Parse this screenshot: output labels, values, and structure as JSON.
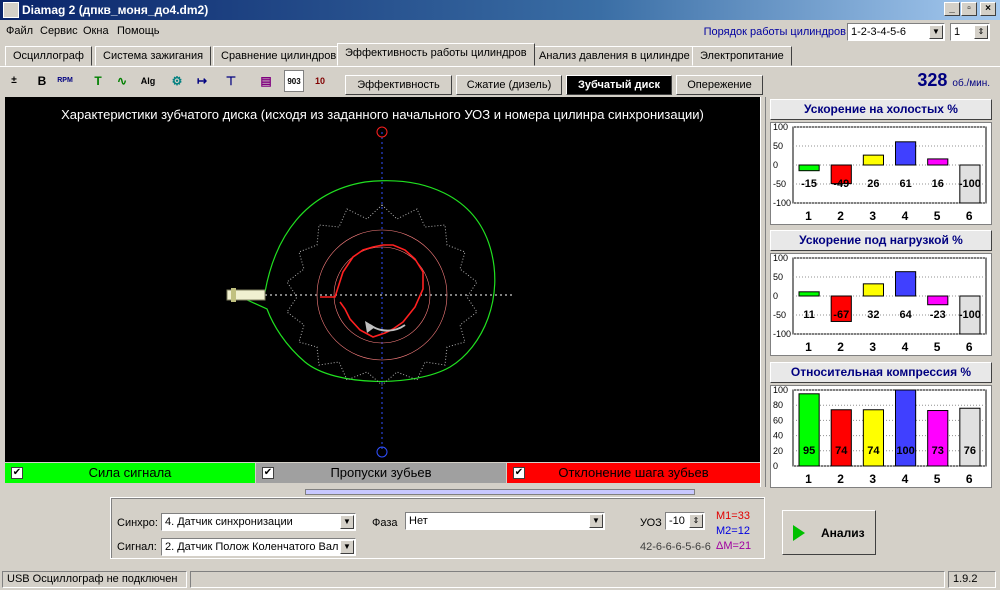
{
  "window": {
    "title": "Diamag 2 (дпкв_моня_до4.dm2)"
  },
  "menu": [
    "Файл",
    "Сервис",
    "Окна",
    "Помощь"
  ],
  "cylinder_order": {
    "label": "Порядок работы цилиндров",
    "value": "1-2-3-4-5-6",
    "cyl_num": "1"
  },
  "tabs": [
    "Осциллограф",
    "Система зажигания",
    "Сравнение цилиндров",
    "Эффективность работы цилиндров",
    "Анализ давления в цилиндре",
    "Электропитание"
  ],
  "toolbar": {
    "icons": [
      "±",
      "B",
      "RPM",
      "T",
      "∿",
      "Alg",
      "⚙",
      "↦",
      "⊤",
      "▤",
      "903",
      "10"
    ]
  },
  "subtabs": [
    "Эффективность",
    "Сжатие (дизель)",
    "Зубчатый диск",
    "Опережение"
  ],
  "rpm": {
    "value": "328",
    "unit": "об./мин."
  },
  "canvas": {
    "title": "Характеристики зубчатого диска (исходя из заданного начального УОЗ и номера цилинра синхронизации)"
  },
  "toggles": [
    {
      "label": "Сила сигнала",
      "color": "#00ff00"
    },
    {
      "label": "Пропуски зубьев",
      "color": "#a0a0a0"
    },
    {
      "label": "Отклонение шага зубьев",
      "color": "#ff0000"
    }
  ],
  "checkmark": "✔",
  "chart_data": [
    {
      "type": "bar",
      "title": "Ускорение на холостых %",
      "categories": [
        "1",
        "2",
        "3",
        "4",
        "5",
        "6"
      ],
      "values": [
        -15,
        -49,
        26,
        61,
        16,
        -100
      ],
      "ylim": [
        -100,
        100
      ],
      "yticks": [
        "100",
        "50",
        "0",
        "-50",
        "-100"
      ]
    },
    {
      "type": "bar",
      "title": "Ускорение под нагрузкой %",
      "categories": [
        "1",
        "2",
        "3",
        "4",
        "5",
        "6"
      ],
      "values": [
        11,
        -67,
        32,
        64,
        -23,
        -100
      ],
      "ylim": [
        -100,
        100
      ],
      "yticks": [
        "100",
        "50",
        "0",
        "-50",
        "-100"
      ]
    },
    {
      "type": "bar",
      "title": "Относительная компрессия %",
      "categories": [
        "1",
        "2",
        "3",
        "4",
        "5",
        "6"
      ],
      "values": [
        95,
        74,
        74,
        100,
        73,
        76
      ],
      "ylim": [
        0,
        100
      ],
      "yticks": [
        "100",
        "80",
        "60",
        "40",
        "20",
        "0"
      ]
    }
  ],
  "bar_colors": [
    "#00ff00",
    "#ff0000",
    "#ffff00",
    "#4040ff",
    "#ff00ff",
    "#e0e0e0"
  ],
  "controls": {
    "synchro_label": "Синхро:",
    "synchro_value": "4. Датчик синхронизации",
    "signal_label": "Сигнал:",
    "signal_value": "2. Датчик Полож Коленчатого Вал",
    "phase_label": "Фаза",
    "phase_value": "Нет",
    "uoz_label": "УОЗ",
    "uoz_value": "-10",
    "teeth_pattern": "42-6-6-6-5-6-6",
    "m1": "M1=33",
    "m2": "M2=12",
    "dm": "ΔM=21",
    "analyze_label": "Анализ"
  },
  "status": {
    "text": "USB Осциллограф не подключен",
    "version": "1.9.2"
  }
}
